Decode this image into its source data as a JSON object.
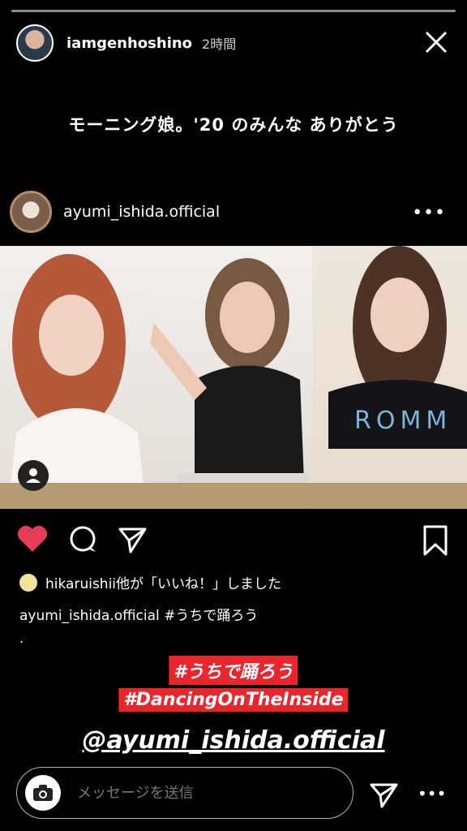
{
  "story": {
    "username": "iamgenhoshino",
    "time": "2時間",
    "caption": "モーニング娘。'20 のみんな ありがとう"
  },
  "post": {
    "username": "ayumi_ishida.official",
    "likes_text": "hikaruishii他が「いいね！」しました",
    "caption_user": "ayumi_ishida.official",
    "caption_text": "#うちで踊ろう",
    "caption_dot": "."
  },
  "stickers": {
    "hashtag1": "#うちで踊ろう",
    "hashtag2": "#DancingOnTheInside",
    "mention": "@ayumi_ishida.official"
  },
  "reply": {
    "placeholder": "メッセージを送信"
  },
  "icons": {
    "close": "close-icon",
    "more": "more-icon",
    "heart": "heart-icon",
    "comment": "comment-icon",
    "share": "share-icon",
    "bookmark": "bookmark-icon",
    "camera": "camera-icon",
    "send": "send-icon",
    "user_tag": "user-tag-icon"
  },
  "colors": {
    "heart": "#e63c55",
    "sticker_bg": "#e8262b",
    "background": "#000000"
  }
}
